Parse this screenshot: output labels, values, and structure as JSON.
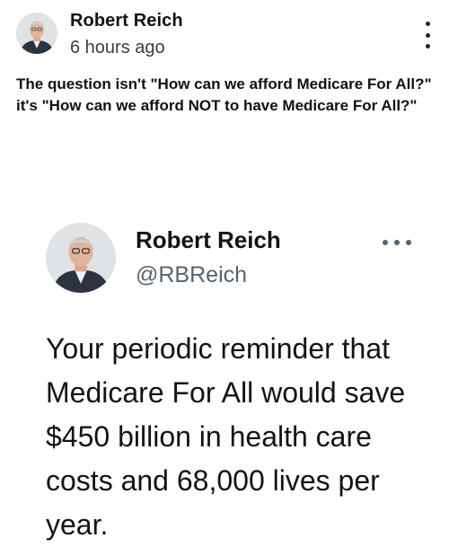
{
  "post": {
    "author_name": "Robert Reich",
    "time_ago": "6 hours ago",
    "text": "The question isn't \"How can we afford Medicare For All?\" it's \"How can we afford NOT to have Medicare For All?\"",
    "avatar_icon": "author-avatar-photo",
    "menu_icon": "kebab-menu-icon"
  },
  "embedded_tweet": {
    "author_name": "Robert Reich",
    "handle": "@RBReich",
    "text": "Your periodic reminder that Medicare For All would save $450 billion in health care costs and 68,000 lives per year.",
    "avatar_icon": "author-avatar-photo",
    "menu_icon": "more-horizontal-icon"
  },
  "colors": {
    "text_primary": "#0f1419",
    "text_secondary": "#536471",
    "background": "#ffffff"
  }
}
